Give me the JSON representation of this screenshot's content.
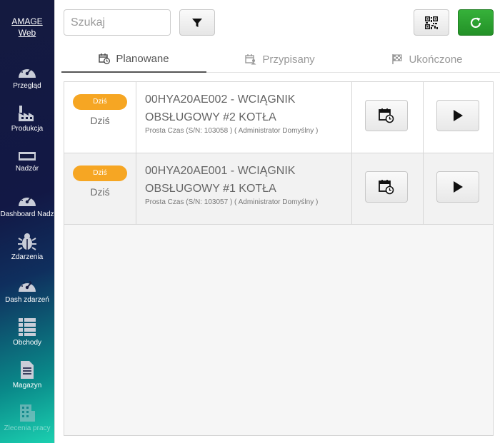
{
  "sidebar": {
    "brand": "AMAGE\nWeb",
    "brand_line1": "AMAGE",
    "brand_line2": "Web",
    "items": [
      {
        "label": "Przegląd",
        "icon": "gauge-icon"
      },
      {
        "label": "Produkcja",
        "icon": "factory-icon"
      },
      {
        "label": "Nadzór",
        "icon": "monitor-icon"
      },
      {
        "label": "Dashboard Nadz",
        "icon": "gauge-icon"
      },
      {
        "label": "Zdarzenia",
        "icon": "bug-icon"
      },
      {
        "label": "Dash zdarzeń",
        "icon": "gauge-icon"
      },
      {
        "label": "Obchody",
        "icon": "list-icon"
      },
      {
        "label": "Magazyn",
        "icon": "document-icon"
      },
      {
        "label": "Zlecenia pracy",
        "icon": "building-icon"
      }
    ]
  },
  "toolbar": {
    "search_placeholder": "Szukaj",
    "filter_icon": "filter-icon",
    "qr_icon": "qr-code-icon",
    "refresh_icon": "refresh-icon",
    "refresh_color": "#2ea232"
  },
  "tabs": [
    {
      "label": "Planowane",
      "icon": "calendar-clock-icon",
      "active": true
    },
    {
      "label": "Przypisany",
      "icon": "calendar-user-icon",
      "active": false
    },
    {
      "label": "Ukończone",
      "icon": "finish-flag-icon",
      "active": false
    }
  ],
  "tasks": [
    {
      "badge": "Dziś",
      "date": "Dziś",
      "title_line1": "00HYA20AE002 - WCIĄGNIK",
      "title_line2": "OBSŁUGOWY #2 KOTŁA",
      "subtitle": "Prosta Czas (S/N: 103058 ) ( Administrator Domyślny )"
    },
    {
      "badge": "Dziś",
      "date": "Dziś",
      "title_line1": "00HYA20AE001 - WCIĄGNIK",
      "title_line2": "OBSŁUGOWY #1 KOTŁA",
      "subtitle": "Prosta Czas (S/N: 103057 ) ( Administrator Domyślny )"
    }
  ],
  "colors": {
    "badge": "#f6a623",
    "accent_green": "#2ea232",
    "sidebar_top": "#141a40",
    "sidebar_bottom": "#1bd0b0"
  }
}
